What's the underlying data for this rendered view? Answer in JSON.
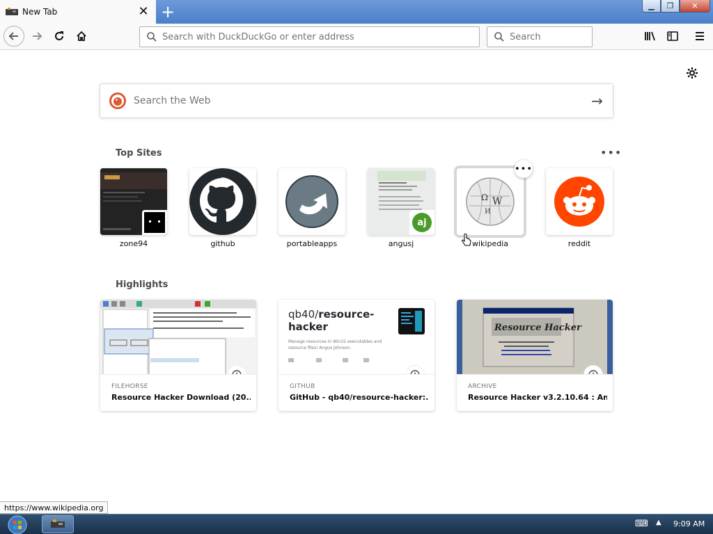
{
  "tab": {
    "title": "New Tab",
    "close_icon": "close-icon"
  },
  "window_controls": [
    "minimize-icon",
    "maximize-icon",
    "close-icon"
  ],
  "navbar": {
    "url_placeholder": "Search with DuckDuckGo or enter address",
    "search_placeholder": "Search"
  },
  "page": {
    "web_search_placeholder": "Search the Web",
    "top_sites_title": "Top Sites",
    "highlights_title": "Highlights",
    "top_sites": [
      {
        "label": "zone94"
      },
      {
        "label": "github"
      },
      {
        "label": "portableapps"
      },
      {
        "label": "angusj"
      },
      {
        "label": "wikipedia"
      },
      {
        "label": "reddit"
      }
    ],
    "highlights": [
      {
        "source": "FILEHORSE",
        "title": "Resource Hacker Download (20..."
      },
      {
        "source": "GITHUB",
        "title": "GitHub - qb40/resource-hacker:..."
      },
      {
        "source": "ARCHIVE",
        "title": "Resource Hacker v3.2.10.64 : An..."
      }
    ],
    "github_card": {
      "repo_owner": "qb40/",
      "repo_name": "resource-hacker",
      "repo_name_line2": "hacker",
      "desc": "Manage resources in Win32 executables and resource files! Angus Johnson."
    },
    "angusj_badge": "aj"
  },
  "status": {
    "hover_url": "https://www.wikipedia.org"
  },
  "taskbar": {
    "time": "9:09 AM"
  },
  "colors": {
    "reddit": "#ff4500",
    "github": "#24292e",
    "titlebar": "#4a7fc9",
    "ddg": "#de5833"
  }
}
